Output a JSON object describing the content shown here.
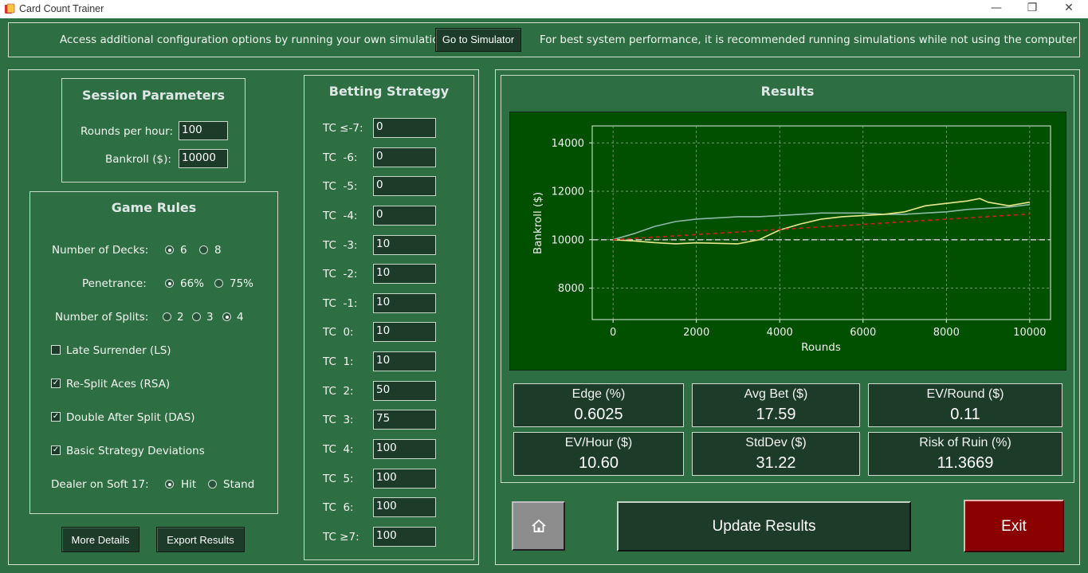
{
  "window": {
    "title": "Card Count Trainer",
    "minimize_glyph": "—",
    "maximize_glyph": "❐",
    "close_glyph": "✕"
  },
  "banner": {
    "left_text": "Access additional configuration options by running your own simulations",
    "button_label": "Go to Simulator",
    "right_text": "For best system performance, it is recommended running simulations while not using the computer"
  },
  "session": {
    "title": "Session Parameters",
    "rounds_label": "Rounds per hour:",
    "rounds_value": "100",
    "bankroll_label": "Bankroll ($):",
    "bankroll_value": "10000"
  },
  "rules": {
    "title": "Game Rules",
    "decks_label": "Number of Decks:",
    "decks_options": [
      "6",
      "8"
    ],
    "penetration_label": "Penetrance:",
    "penetration_options": [
      "66%",
      "75%"
    ],
    "splits_label": "Number of Splits:",
    "splits_options": [
      "2",
      "3",
      "4"
    ],
    "ls_label": "Late Surrender (LS)",
    "rsa_label": "Re-Split Aces (RSA)",
    "das_label": "Double After Split (DAS)",
    "bsd_label": "Basic Strategy Deviations",
    "soft17_label": "Dealer on Soft 17:",
    "soft17_options": [
      "Hit",
      "Stand"
    ],
    "check_mark": "✓"
  },
  "bottom_buttons": {
    "details": "More Details",
    "export": "Export Results"
  },
  "betting": {
    "title": "Betting Strategy",
    "rows": [
      {
        "label": "TC ≤-7:",
        "value": "0"
      },
      {
        "label": "TC  -6:",
        "value": "0"
      },
      {
        "label": "TC  -5:",
        "value": "0"
      },
      {
        "label": "TC  -4:",
        "value": "0"
      },
      {
        "label": "TC  -3:",
        "value": "10"
      },
      {
        "label": "TC  -2:",
        "value": "10"
      },
      {
        "label": "TC  -1:",
        "value": "10"
      },
      {
        "label": "TC  0:",
        "value": "10"
      },
      {
        "label": "TC  1:",
        "value": "10"
      },
      {
        "label": "TC  2:",
        "value": "50"
      },
      {
        "label": "TC  3:",
        "value": "75"
      },
      {
        "label": "TC  4:",
        "value": "100"
      },
      {
        "label": "TC  5:",
        "value": "100"
      },
      {
        "label": "TC  6:",
        "value": "100"
      },
      {
        "label": "TC ≥7:",
        "value": "100"
      }
    ]
  },
  "results": {
    "title": "Results",
    "stats": [
      {
        "label": "Edge (%)",
        "value": "0.6025"
      },
      {
        "label": "Avg Bet ($)",
        "value": "17.59"
      },
      {
        "label": "EV/Round ($)",
        "value": "0.11"
      },
      {
        "label": "EV/Hour ($)",
        "value": "10.60"
      },
      {
        "label": "StdDev ($)",
        "value": "31.22"
      },
      {
        "label": "Risk of Ruin (%)",
        "value": "11.3669"
      }
    ]
  },
  "actions": {
    "home_icon": "home-icon",
    "update": "Update Results",
    "exit": "Exit"
  },
  "colors": {
    "background": "#2e6e43",
    "plot_bg": "#005000",
    "exit": "#8b0000",
    "yellow_series": "#e8e88a",
    "teal_series": "#8fb8a8",
    "trend": "#cc1f1f"
  },
  "chart_data": {
    "type": "line",
    "title": "",
    "xlabel": "Rounds",
    "ylabel": "Bankroll ($)",
    "xlim": [
      -500,
      10500
    ],
    "ylim": [
      6700,
      14700
    ],
    "xticks": [
      0,
      2000,
      4000,
      6000,
      8000,
      10000
    ],
    "yticks": [
      8000,
      10000,
      12000,
      14000
    ],
    "grid": true,
    "series": [
      {
        "style": "solid",
        "color": "#e8e88a",
        "x": [
          0,
          500,
          1000,
          1500,
          2000,
          2500,
          3000,
          3500,
          4000,
          4500,
          5000,
          5500,
          6000,
          6500,
          7000,
          7500,
          8000,
          8500,
          8800,
          9000,
          9500,
          10000
        ],
        "y": [
          10000,
          9950,
          9880,
          9830,
          9870,
          9850,
          9830,
          10000,
          10400,
          10650,
          10850,
          10950,
          11000,
          11050,
          11150,
          11400,
          11500,
          11600,
          11700,
          11550,
          11400,
          11550
        ]
      },
      {
        "style": "solid",
        "color": "#8fb8a8",
        "x": [
          0,
          500,
          1000,
          1500,
          2000,
          2500,
          3000,
          3500,
          4000,
          4500,
          5000,
          5500,
          6000,
          6500,
          7000,
          7500,
          8000,
          8500,
          9000,
          9500,
          10000
        ],
        "y": [
          10000,
          10250,
          10550,
          10750,
          10850,
          10900,
          10950,
          10950,
          11000,
          11050,
          11100,
          11100,
          11100,
          11050,
          11050,
          11100,
          11150,
          11250,
          11300,
          11350,
          11450
        ]
      },
      {
        "style": "dashed",
        "color": "#cc1f1f",
        "x": [
          0,
          10000
        ],
        "y": [
          10000,
          11060
        ]
      },
      {
        "style": "dashed",
        "color": "#bfbfbf",
        "x": [
          -500,
          10500
        ],
        "y": [
          10000,
          10000
        ]
      }
    ]
  }
}
